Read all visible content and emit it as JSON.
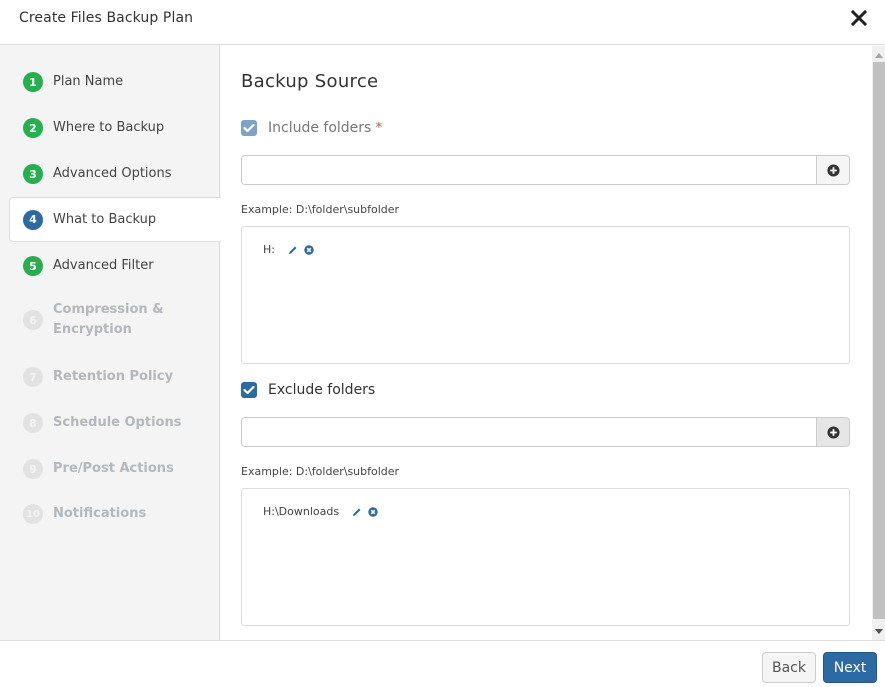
{
  "dialog": {
    "title": "Create Files Backup Plan",
    "close_icon": "close-icon"
  },
  "steps": [
    {
      "number": "1",
      "label": "Plan Name",
      "state": "done"
    },
    {
      "number": "2",
      "label": "Where to Backup",
      "state": "done"
    },
    {
      "number": "3",
      "label": "Advanced Options",
      "state": "done"
    },
    {
      "number": "4",
      "label": "What to Backup",
      "state": "current"
    },
    {
      "number": "5",
      "label": "Advanced Filter",
      "state": "done"
    },
    {
      "number": "6",
      "label": "Compression & Encryption",
      "state": "pending"
    },
    {
      "number": "7",
      "label": "Retention Policy",
      "state": "pending"
    },
    {
      "number": "8",
      "label": "Schedule Options",
      "state": "pending"
    },
    {
      "number": "9",
      "label": "Pre/Post Actions",
      "state": "pending"
    },
    {
      "number": "10",
      "label": "Notifications",
      "state": "pending"
    }
  ],
  "main": {
    "section_title": "Backup Source",
    "include": {
      "label": "Include folders",
      "required_mark": "*",
      "checked": true,
      "disabled": true,
      "input_value": "",
      "input_placeholder": "",
      "hint": "Example: D:\\folder\\subfolder",
      "items": [
        "H:"
      ]
    },
    "exclude": {
      "label": "Exclude folders",
      "checked": true,
      "disabled": false,
      "input_value": "",
      "input_placeholder": "",
      "hint": "Example: D:\\folder\\subfolder",
      "items": [
        "H:\\Downloads"
      ]
    }
  },
  "footer": {
    "back_label": "Back",
    "next_label": "Next"
  },
  "colors": {
    "accent": "#2d6aa3",
    "step_done": "#27ae4f",
    "step_pending": "#e2e2e2",
    "required": "#e74c3c"
  }
}
